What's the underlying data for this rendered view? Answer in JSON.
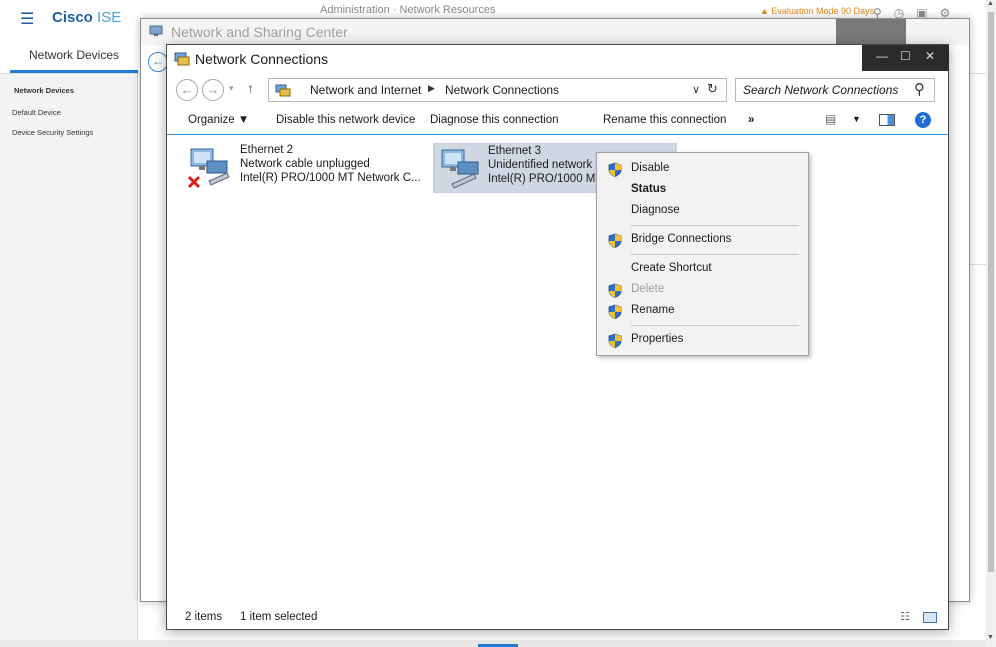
{
  "ise": {
    "brand_bold": "Cisco",
    "brand_thin": "ISE",
    "breadcrumb": "Administration · Network Resources",
    "alert_text": "Evaluation Mode 90 Days",
    "tab": "Network Devices",
    "sidebar": [
      "Network Devices",
      "Default Device",
      "Device Security Settings"
    ]
  },
  "sharing_center": {
    "title": "Network and Sharing Center"
  },
  "window": {
    "title": "Network Connections",
    "address": [
      "Network and Internet",
      "Network Connections"
    ],
    "search_placeholder": "Search Network Connections"
  },
  "toolbar": {
    "organize": "Organize",
    "disable": "Disable this network device",
    "diagnose": "Diagnose this connection",
    "rename": "Rename this connection",
    "more": "»"
  },
  "connections": [
    {
      "name": "Ethernet 2",
      "status": "Network cable unplugged",
      "adapter": "Intel(R) PRO/1000 MT Network C..."
    },
    {
      "name": "Ethernet 3",
      "status": "Unidentified network",
      "adapter": "Intel(R) PRO/1000 MT"
    }
  ],
  "statusbar": {
    "count": "2 items",
    "selected": "1 item selected"
  },
  "context_menu": [
    {
      "label": "Disable",
      "shield": true
    },
    {
      "label": "Status",
      "bold": true
    },
    {
      "label": "Diagnose"
    },
    {
      "label": "Bridge Connections",
      "shield": true
    },
    {
      "label": "Create Shortcut"
    },
    {
      "label": "Delete",
      "shield": true,
      "disabled": true
    },
    {
      "label": "Rename",
      "shield": true
    },
    {
      "label": "Properties",
      "shield": true
    }
  ],
  "colors": {
    "accent": "#1f7bd6",
    "selection": "#cfd7e3",
    "cisco_blue": "#1f5fa8"
  }
}
